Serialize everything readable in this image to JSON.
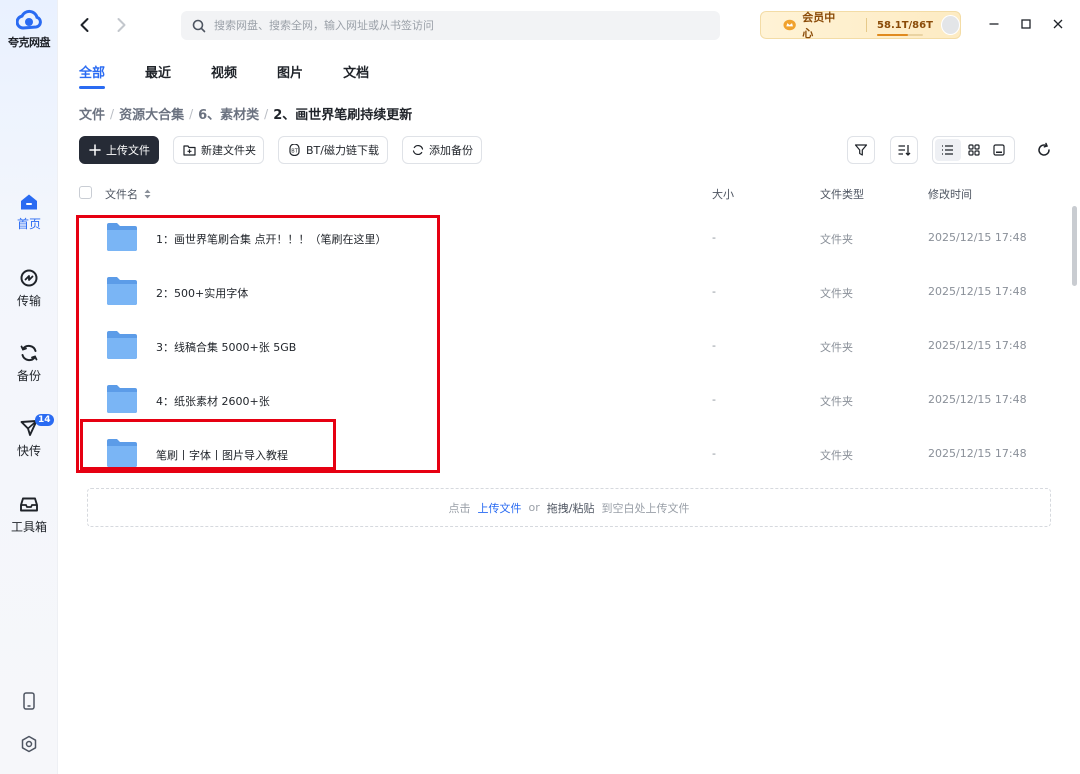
{
  "app": {
    "logo_text": "夸克网盘"
  },
  "rail": {
    "items": [
      {
        "label": "首页",
        "icon": "home-icon"
      },
      {
        "label": "传输",
        "icon": "transfer-icon"
      },
      {
        "label": "备份",
        "icon": "backup-icon"
      },
      {
        "label": "快传",
        "icon": "send-icon",
        "badge": "14"
      },
      {
        "label": "工具箱",
        "icon": "toolbox-icon"
      }
    ],
    "bottom": [
      {
        "icon": "phone-icon"
      },
      {
        "icon": "settings-icon"
      }
    ],
    "accent": "#2a6bf2"
  },
  "search": {
    "placeholder": "搜索网盘、搜索全网，输入网址或从书签访问"
  },
  "vip": {
    "label": "会员中心",
    "quota": "58.1T/86T",
    "used_percent": 67.6
  },
  "tabs": [
    "全部",
    "最近",
    "视频",
    "图片",
    "文档"
  ],
  "breadcrumb": [
    "文件",
    "资源大合集",
    "6、素材类",
    "2、画世界笔刷持续更新"
  ],
  "toolbar": {
    "upload": "上传文件",
    "new_folder": "新建文件夹",
    "bt_download": "BT/磁力链下载",
    "add_backup": "添加备份"
  },
  "table": {
    "headers": {
      "name": "文件名",
      "size": "大小",
      "type": "文件类型",
      "modified": "修改时间"
    },
    "rows": [
      {
        "name": "1：画世界笔刷合集 点开！！！（笔刷在这里）",
        "size": "-",
        "type": "文件夹",
        "modified": "2025/12/15 17:48"
      },
      {
        "name": "2：500+实用字体",
        "size": "-",
        "type": "文件夹",
        "modified": "2025/12/15 17:48"
      },
      {
        "name": "3：线稿合集 5000+张 5GB",
        "size": "-",
        "type": "文件夹",
        "modified": "2025/12/15 17:48"
      },
      {
        "name": "4：纸张素材 2600+张",
        "size": "-",
        "type": "文件夹",
        "modified": "2025/12/15 17:48"
      },
      {
        "name": "笔刷丨字体丨图片导入教程",
        "size": "-",
        "type": "文件夹",
        "modified": "2025/12/15 17:48"
      }
    ]
  },
  "dropzone": {
    "prefix": "点击",
    "upload_link": "上传文件",
    "or": "or",
    "drag": "拖拽/粘贴",
    "suffix": "到空白处上传文件"
  },
  "colors": {
    "accent": "#2a6bf2",
    "annotation": "#e60012",
    "folder": "#6aa8f2"
  }
}
